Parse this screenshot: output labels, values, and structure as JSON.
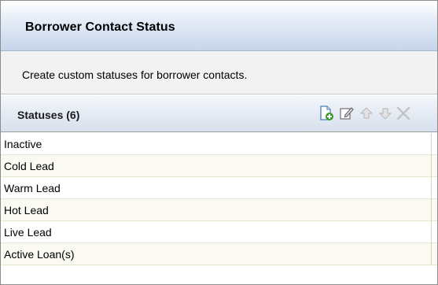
{
  "panel": {
    "title": "Borrower Contact Status",
    "description": "Create custom statuses for borrower contacts."
  },
  "list": {
    "header": "Statuses (6)",
    "toolbar": [
      {
        "name": "new-status-icon",
        "enabled": true
      },
      {
        "name": "edit-icon",
        "enabled": true
      },
      {
        "name": "move-up-icon",
        "enabled": false
      },
      {
        "name": "move-down-icon",
        "enabled": false
      },
      {
        "name": "delete-icon",
        "enabled": false
      }
    ],
    "items": [
      {
        "label": "Inactive"
      },
      {
        "label": "Cold Lead"
      },
      {
        "label": "Warm Lead"
      },
      {
        "label": "Hot Lead"
      },
      {
        "label": "Live Lead"
      },
      {
        "label": "Active Loan(s)"
      }
    ]
  },
  "colors": {
    "title_gradient_end": "#c6d5ea",
    "row_divider": "#e8e4cf",
    "disabled_icon": "#bdbdbd"
  }
}
